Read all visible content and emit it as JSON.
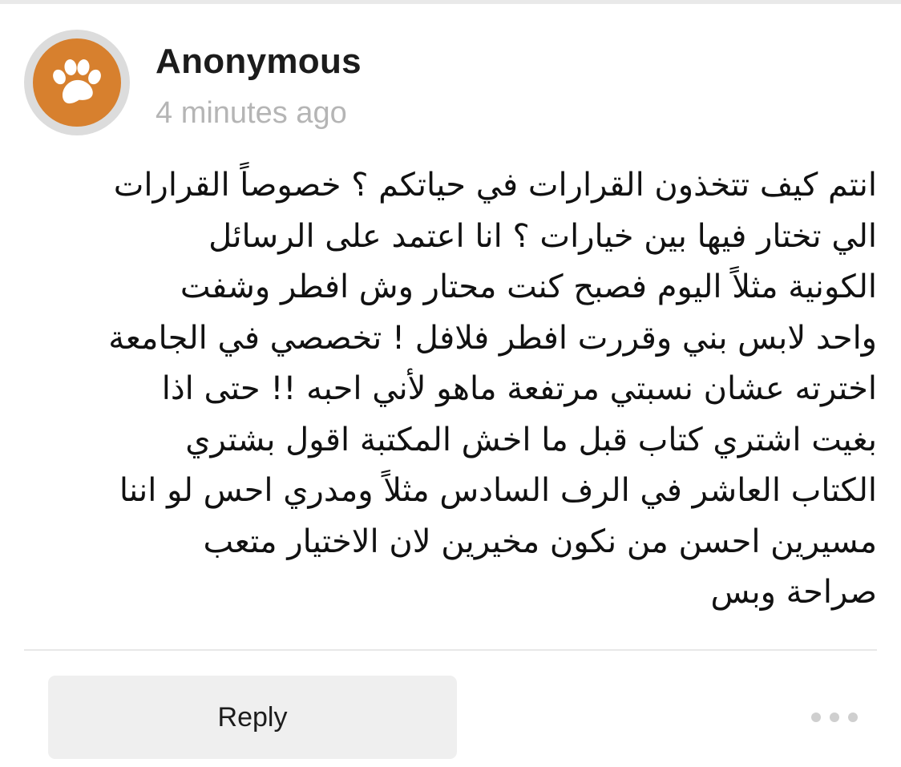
{
  "post": {
    "author": "Anonymous",
    "time_ago": "4 minutes ago",
    "avatar": {
      "icon": "paw-icon",
      "background_color": "#d7802e",
      "ring_color": "#dcdcdc"
    },
    "message_lines": [
      "انتم كيف تتخذون القرارات في حياتكم ؟ خصوصاً القرارات",
      "الي تختار فيها بين خيارات ؟ انا اعتمد على الرسائل",
      "الكونية مثلاً اليوم فصبح كنت محتار وش افطر وشفت",
      "واحد لابس بني وقررت افطر فلافل ! تخصصي في الجامعة",
      "اخترته عشان نسبتي مرتفعة ماهو لأني احبه !! حتى اذا",
      "بغيت اشتري كتاب قبل ما اخش المكتبة اقول بشتري",
      "الكتاب العاشر في الرف السادس مثلاً ومدري احس لو اننا",
      "مسيرين احسن من نكون مخيرين لان الاختيار متعب",
      "صراحة وبس"
    ]
  },
  "actions": {
    "reply_label": "Reply",
    "more_icon": "ellipsis-icon"
  }
}
